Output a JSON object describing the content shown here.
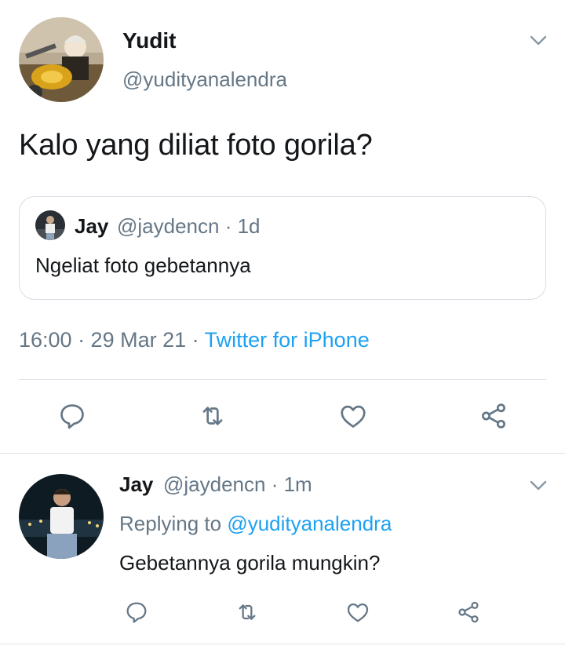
{
  "main_tweet": {
    "name": "Yudit",
    "handle": "@yudityanalendra",
    "text": "Kalo yang diliat foto gorila?",
    "quoted": {
      "name": "Jay",
      "handle_time": "@jaydencn · 1d",
      "text": "Ngeliat foto gebetannya"
    },
    "time": "16:00 · 29 Mar 21 · ",
    "source": "Twitter for iPhone",
    "actions": [
      "reply-icon",
      "retweet-icon",
      "like-icon",
      "share-icon"
    ]
  },
  "reply_tweet": {
    "name": "Jay",
    "handle_time": "@jaydencn · 1m",
    "replying_prefix": "Replying to ",
    "replying_handle": "@yudityanalendra",
    "text": "Gebetannya gorila mungkin?",
    "actions": [
      "reply-icon",
      "retweet-icon",
      "like-icon",
      "share-icon"
    ]
  },
  "colors": {
    "text": "#14171a",
    "muted": "#657786",
    "link": "#1da1f2",
    "divider": "#dde3e8"
  }
}
